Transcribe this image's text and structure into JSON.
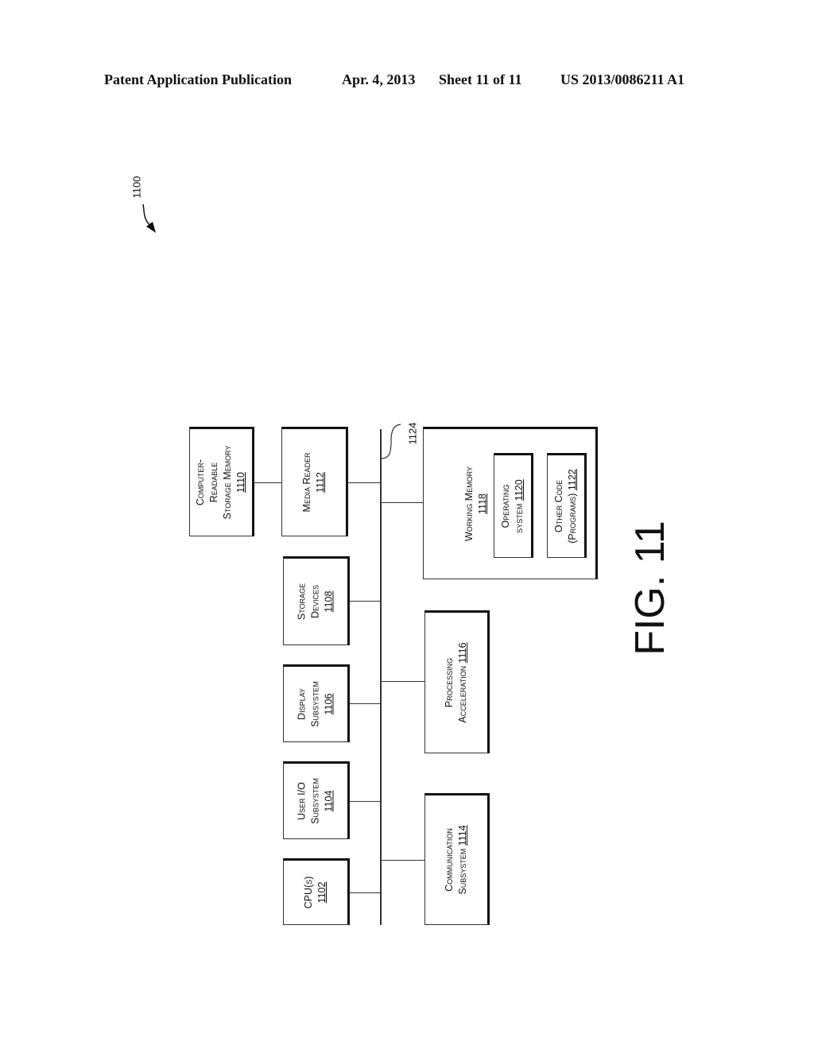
{
  "header": {
    "publication": "Patent Application Publication",
    "date": "Apr. 4, 2013",
    "sheet": "Sheet 11 of 11",
    "number": "US 2013/0086211 A1"
  },
  "figure": {
    "ref": "1100",
    "label": "FIG. 11",
    "bus_ref": "1124"
  },
  "boxes": {
    "crsm": {
      "line1": "Computer-",
      "line2": "Readable",
      "line3": "Storage Memory",
      "num": "1110"
    },
    "media": {
      "line1": "Media Reader",
      "num": "1112"
    },
    "storage": {
      "line1": "Storage",
      "line2": "Devices",
      "num": "1108"
    },
    "display": {
      "line1": "Display",
      "line2": "Subsystem",
      "num": "1106"
    },
    "userio": {
      "line1": "User I/O",
      "line2": "Subsystem",
      "num": "1104"
    },
    "cpu": {
      "line1": "CPU(s)",
      "num": "1102"
    },
    "working": {
      "line1": "Working Memory",
      "num": "1118"
    },
    "os": {
      "line1": "Operating",
      "line2": "system",
      "num": "1120"
    },
    "other": {
      "line1": "Other Code",
      "line2": "(Programs)",
      "num": "1122"
    },
    "procacc": {
      "line1": "Processing",
      "line2": "Acceleration",
      "num": "1116"
    },
    "comm": {
      "line1": "Communication",
      "line2": "Subsystem",
      "num": "1114"
    }
  }
}
